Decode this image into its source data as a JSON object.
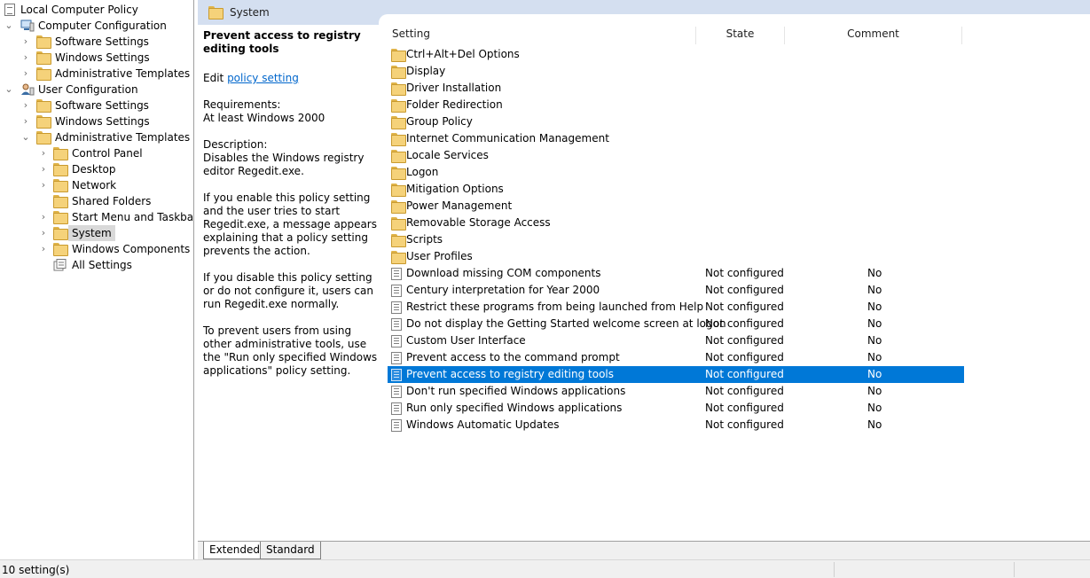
{
  "tree": {
    "root": {
      "label": "Local Computer Policy",
      "icon": "policy-icon"
    },
    "computer_config": {
      "label": "Computer Configuration",
      "icon": "computer-icon"
    },
    "cc_software": {
      "label": "Software Settings"
    },
    "cc_windows": {
      "label": "Windows Settings"
    },
    "cc_admin": {
      "label": "Administrative Templates"
    },
    "user_config": {
      "label": "User Configuration",
      "icon": "user-icon"
    },
    "uc_software": {
      "label": "Software Settings"
    },
    "uc_windows": {
      "label": "Windows Settings"
    },
    "uc_admin": {
      "label": "Administrative Templates"
    },
    "control_panel": {
      "label": "Control Panel"
    },
    "desktop": {
      "label": "Desktop"
    },
    "network": {
      "label": "Network"
    },
    "shared_folders": {
      "label": "Shared Folders"
    },
    "start_menu": {
      "label": "Start Menu and Taskbar"
    },
    "system": {
      "label": "System"
    },
    "windows_components": {
      "label": "Windows Components"
    },
    "all_settings": {
      "label": "All Settings"
    }
  },
  "header": {
    "title": "System"
  },
  "description": {
    "title": "Prevent access to registry editing tools",
    "edit_prefix": "Edit ",
    "edit_link": "policy setting ",
    "requirements_label": "Requirements:",
    "requirements_value": "At least Windows 2000",
    "description_label": "Description:",
    "description_value": "Disables the Windows registry editor Regedit.exe.",
    "para_enable": "If you enable this policy setting and the user tries to start Regedit.exe, a message appears explaining that a policy setting prevents the action.",
    "para_disable": "If you disable this policy setting or do not configure it, users can run Regedit.exe normally.",
    "para_prevent": "To prevent users from using other administrative tools, use the \"Run only specified Windows applications\" policy setting."
  },
  "columns": {
    "setting": "Setting",
    "state": "State",
    "comment": "Comment"
  },
  "folders": [
    "Ctrl+Alt+Del Options",
    "Display",
    "Driver Installation",
    "Folder Redirection",
    "Group Policy",
    "Internet Communication Management",
    "Locale Services",
    "Logon",
    "Mitigation Options",
    "Power Management",
    "Removable Storage Access",
    "Scripts",
    "User Profiles"
  ],
  "settings": [
    {
      "name": "Download missing COM components",
      "state": "Not configured",
      "comment": "No"
    },
    {
      "name": "Century interpretation for Year 2000",
      "state": "Not configured",
      "comment": "No"
    },
    {
      "name": "Restrict these programs from being launched from Help",
      "state": "Not configured",
      "comment": "No"
    },
    {
      "name": "Do not display the Getting Started welcome screen at logon",
      "state": "Not configured",
      "comment": "No"
    },
    {
      "name": "Custom User Interface",
      "state": "Not configured",
      "comment": "No"
    },
    {
      "name": "Prevent access to the command prompt",
      "state": "Not configured",
      "comment": "No"
    },
    {
      "name": "Prevent access to registry editing tools",
      "state": "Not configured",
      "comment": "No"
    },
    {
      "name": "Don't run specified Windows applications",
      "state": "Not configured",
      "comment": "No"
    },
    {
      "name": "Run only specified Windows applications",
      "state": "Not configured",
      "comment": "No"
    },
    {
      "name": "Windows Automatic Updates",
      "state": "Not configured",
      "comment": "No"
    }
  ],
  "tabs": {
    "extended": "Extended",
    "standard": "Standard"
  },
  "status": {
    "text": "10 setting(s)"
  },
  "colors": {
    "selection": "#0078d7",
    "header_bg": "#d4dff0",
    "link": "#0066cc"
  }
}
